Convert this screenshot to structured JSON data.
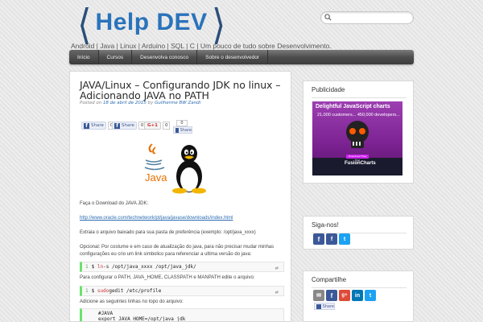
{
  "header": {
    "logo_text": "Help DEV",
    "tagline": "Android | Java | Linux | Arduino | SQL | C | Um pouco de tudo sobre Desenvolvimento.",
    "search_placeholder": ""
  },
  "nav": {
    "items": [
      {
        "label": "Início"
      },
      {
        "label": "Cursos"
      },
      {
        "label": "Desenvolva conosco"
      },
      {
        "label": "Sobre o desenvolvedor"
      }
    ]
  },
  "post": {
    "title": "JAVA/Linux – Configurando JDK no linux – Adicionando JAVA no PATH",
    "meta_prefix": "Posted on",
    "date": "18 de abril de 2015",
    "meta_by": "by",
    "author": "Guilherme BW Zandi",
    "share": {
      "fb_share_label": "Share",
      "fb_share_count": "0",
      "fb_label2": "Share",
      "fb_count2": "0",
      "gplus_label": "G+1",
      "gplus_count": "0",
      "fb_small_label": "Share",
      "bubble_count": "0"
    },
    "illustration_text": "Java",
    "p1": "Faça o Download do JAVA JDK:",
    "link": "http://www.oracle.com/technetwork/pt/java/javase/downloads/index.html",
    "p2": "Extraia o arquivo baixado para sua pasta de preferência (exemplo: /opt/java_xxxx)",
    "p3": "Opcional: Por costume e em caso de atualização do java, para não precisar mudar minhas configurações eu crio um link simbolico para referenciar a ultima versão do java:",
    "code1": {
      "ln": "1",
      "prompt": "$",
      "cmd": "ln",
      "args": " -s /opt/java_xxxx /opt/java_jdk/"
    },
    "p4": "Para configurar o PATH, JAVA_HOME, CLASSPATH e MANPATH edite o arquivo:",
    "code2": {
      "ln": "1",
      "prompt": "$",
      "cmd": "sudo",
      "args": " gedit /etc/profile"
    },
    "p5": "Adicione as seguintes linhas no topo do arquivo:",
    "code3": "#JAVA\nexport JAVA_HOME=/opt/java_jdk\nexport CLASSPATH=\"$JAVA_HOME/lib\""
  },
  "sidebar": {
    "publicidade_title": "Publicidade",
    "ad": {
      "headline": "Delightful JavaScript charts",
      "sub": "21,000 customers... 450,000 developers...",
      "download": "Download Free Trial",
      "brand": "FusionCharts"
    },
    "siga_title": "Siga-nos!",
    "compartilhe_title": "Compartilhe",
    "share_label": "Share",
    "colors": {
      "facebook": "#3b5998",
      "twitter": "#1da1f2",
      "gplus": "#dd4b39",
      "linkedin": "#0077b5",
      "email": "#888888"
    }
  }
}
